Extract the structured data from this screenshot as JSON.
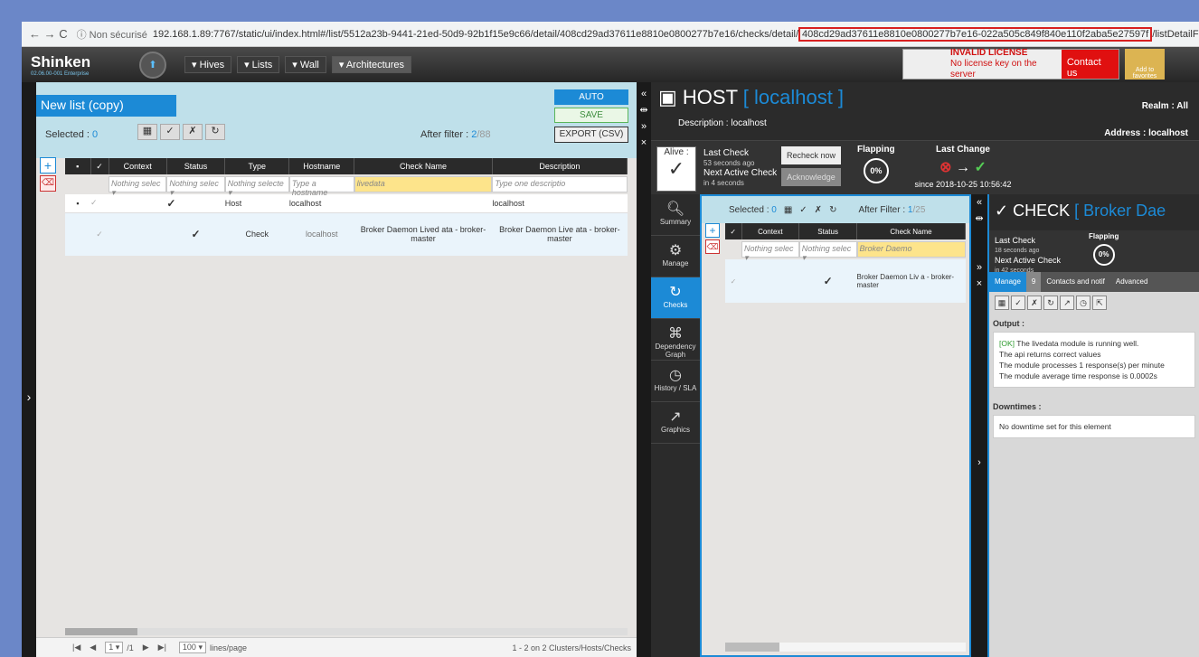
{
  "browser": {
    "nav": "← → C",
    "security": "ⓘ Non sécurisé",
    "url_main": "192.168.1.89:7767/static/ui/index.html#/list/5512a23b-9441-21ed-50d9-92b1f15e9c66/detail/408cd29ad37611e8810e0800277b7e16/checks/detail/",
    "url_highlight": "408cd29ad37611e8810e0800277b7e16-022a505c849f840e110f2aba5e27597f",
    "url_tail": "/listDetailFilter...",
    "right_icons": "⊶ ▣ ☆"
  },
  "topbar": {
    "logo": "Shinken",
    "logo_sub": "02.06.00-001 Enterprise",
    "menu": [
      "▾ Hives",
      "▾ Lists",
      "▾ Wall",
      "▾ Architectures"
    ],
    "license_title": "INVALID LICENSE",
    "license_text": "No license key on the server",
    "contact": "Contact us",
    "favorites": "Add to favorites"
  },
  "list": {
    "title": "New list (copy)",
    "selected_label": "Selected :",
    "selected_count": "0",
    "after_filter_label": "After filter :",
    "after_filter_value": "2",
    "after_filter_total": "/88",
    "auto": "AUTO",
    "save": "SAVE",
    "export": "EXPORT (CSV)",
    "columns": [
      "Context",
      "Status",
      "Type",
      "Hostname",
      "Check Name",
      "Description"
    ],
    "filters": [
      "Nothing selec ▾",
      "Nothing selec ▾",
      "Nothing selecte ▾",
      "Type a hostname",
      "livedata",
      "Type one descriptio"
    ],
    "rows": [
      {
        "status": "✓",
        "type": "Host",
        "hostname": "localhost",
        "check": "",
        "desc": "localhost"
      },
      {
        "status": "✓",
        "type": "Check",
        "hostname": "localhost",
        "check": "Broker Daemon Lived ata - broker-master",
        "desc": "Broker Daemon Live ata - broker-master"
      }
    ],
    "page": "1 ▾",
    "page_total": "/1",
    "lines": "100 ▾",
    "lines_label": "lines/page",
    "count_text": "1 - 2 on 2 Clusters/Hosts/Checks"
  },
  "host": {
    "title_prefix": "HOST",
    "title_name": "[ localhost ]",
    "description": "Description : localhost",
    "realm": "Realm : All",
    "address": "Address : localhost",
    "alive": "Alive :",
    "last_check": "Last Check",
    "last_check_ago": "53 seconds ago",
    "next_check": "Next Active Check",
    "next_check_in": "in 4 seconds",
    "recheck": "Recheck now",
    "acknowledge": "Acknowledge",
    "flapping": "Flapping",
    "flap_pct": "0%",
    "last_change": "Last Change",
    "since": "since 2018-10-25 10:56:42"
  },
  "vtabs": [
    "Summary",
    "Manage",
    "Checks",
    "Dependency Graph",
    "History / SLA",
    "Graphics"
  ],
  "checks": {
    "selected_label": "Selected :",
    "selected_count": "0",
    "after": "After Filter :",
    "after_val": "1",
    "after_total": "/25",
    "columns": [
      "Context",
      "Status",
      "Check Name"
    ],
    "filters": [
      "Nothing selec ▾",
      "Nothing selec ▾",
      "Broker Daemo"
    ],
    "row_name": "Broker Daemon Liv a - broker-master"
  },
  "check": {
    "title_prefix": "CHECK",
    "title_name": "[ Broker Dae",
    "last_check": "Last Check",
    "last_ago": "18 seconds ago",
    "next": "Next Active Check",
    "next_in": "in 42 seconds",
    "flapping": "Flapping",
    "flap_pct": "0%",
    "tabs": [
      "Manage",
      "9",
      "Contacts and notif",
      "Advanced"
    ],
    "output_label": "Output :",
    "output_ok": "[OK]",
    "output_lines": [
      "The livedata module is running well.",
      "The api returns correct values",
      "The module processes 1 response(s) per minute",
      "The module average time response is 0.0002s"
    ],
    "downtimes_label": "Downtimes :",
    "downtimes_text": "No downtime set for this element"
  }
}
